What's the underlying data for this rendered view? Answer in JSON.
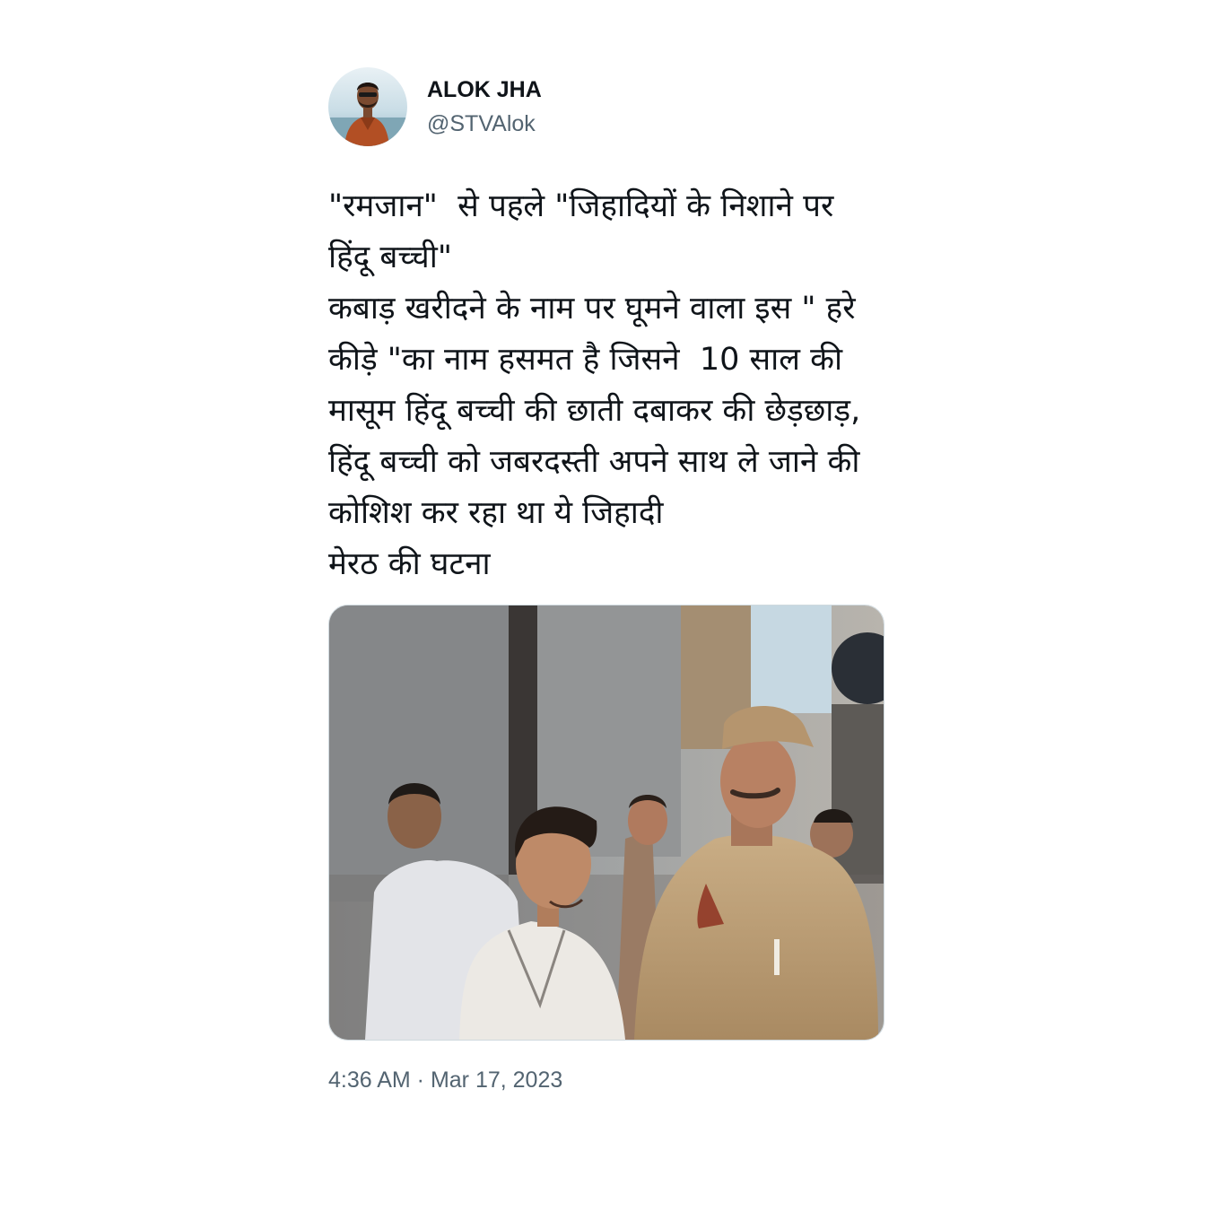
{
  "tweet": {
    "author": {
      "display_name": "ALOK JHA",
      "handle": "@STVAlok"
    },
    "text": "\"रमजान\"  से पहले \"जिहादियों के निशाने पर हिंदू बच्ची\"\nकबाड़ खरीदने के नाम पर घूमने वाला इस \" हरे कीड़े \"का नाम हसमत है जिसने  10 साल की मासूम हिंदू बच्ची की छाती दबाकर की छेड़छाड़, हिंदू बच्ची को जबरदस्ती अपने साथ ले जाने की कोशिश कर रहा था ये जिहादी\nमेरठ की घटना",
    "timestamp": "4:36 AM · Mar 17, 2023"
  }
}
